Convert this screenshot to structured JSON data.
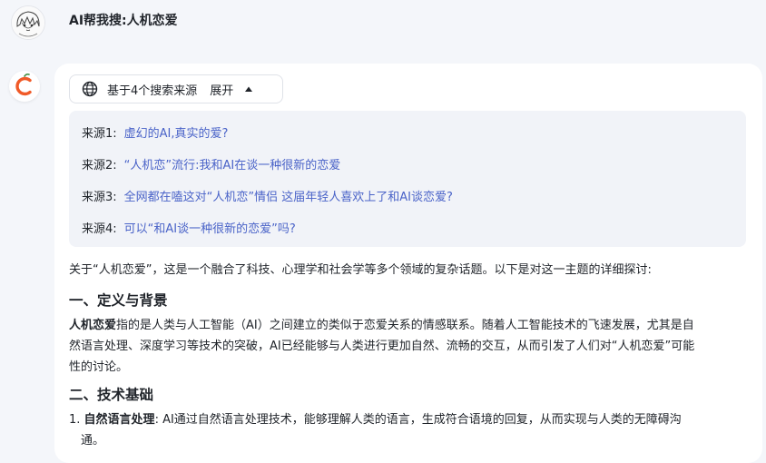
{
  "user": {
    "avatar_icon": "anime-character-avatar",
    "query": "AI帮我搜:人机恋爱"
  },
  "assistant": {
    "avatar_icon": "orange-c-logo-icon",
    "brand_color": "#f05a28"
  },
  "sources_toggle": {
    "icon": "globe-icon",
    "label": "基于4个搜索来源",
    "expand_label": "展开",
    "caret_icon": "caret-up-icon"
  },
  "sources": [
    {
      "tag": "来源1:",
      "title": "虚幻的AI,真实的爱?"
    },
    {
      "tag": "来源2:",
      "title": "“人机恋”流行:我和AI在谈一种很新的恋爱"
    },
    {
      "tag": "来源3:",
      "title": "全网都在嗑这对“人机恋”情侣 这届年轻人喜欢上了和AI谈恋爱?"
    },
    {
      "tag": "来源4:",
      "title": "可以“和AI谈一种很新的恋爱”吗?"
    }
  ],
  "answer": {
    "intro": "关于“人机恋爱”，这是一个融合了科技、心理学和社会学等多个领域的复杂话题。以下是对这一主题的详细探讨:",
    "section1_heading": "一、定义与背景",
    "section1_term": "人机恋爱",
    "section1_line1_rest": "指的是人类与人工智能（AI）之间建立的类似于恋爱关系的情感联系。随着人工智能技术的飞速发展，尤其是自",
    "section1_line2": "然语言处理、深度学习等技术的突破，AI已经能够与人类进行更加自然、流畅的交互，从而引发了人们对“人机恋爱”可能",
    "section1_line3": "性的讨论。",
    "section2_heading": "二、技术基础",
    "item1_number": "1.",
    "item1_term": "自然语言处理",
    "item1_line1_rest": ": AI通过自然语言处理技术，能够理解人类的语言，生成符合语境的回复，从而实现与人类的无障碍沟",
    "item1_line2": "通。"
  }
}
